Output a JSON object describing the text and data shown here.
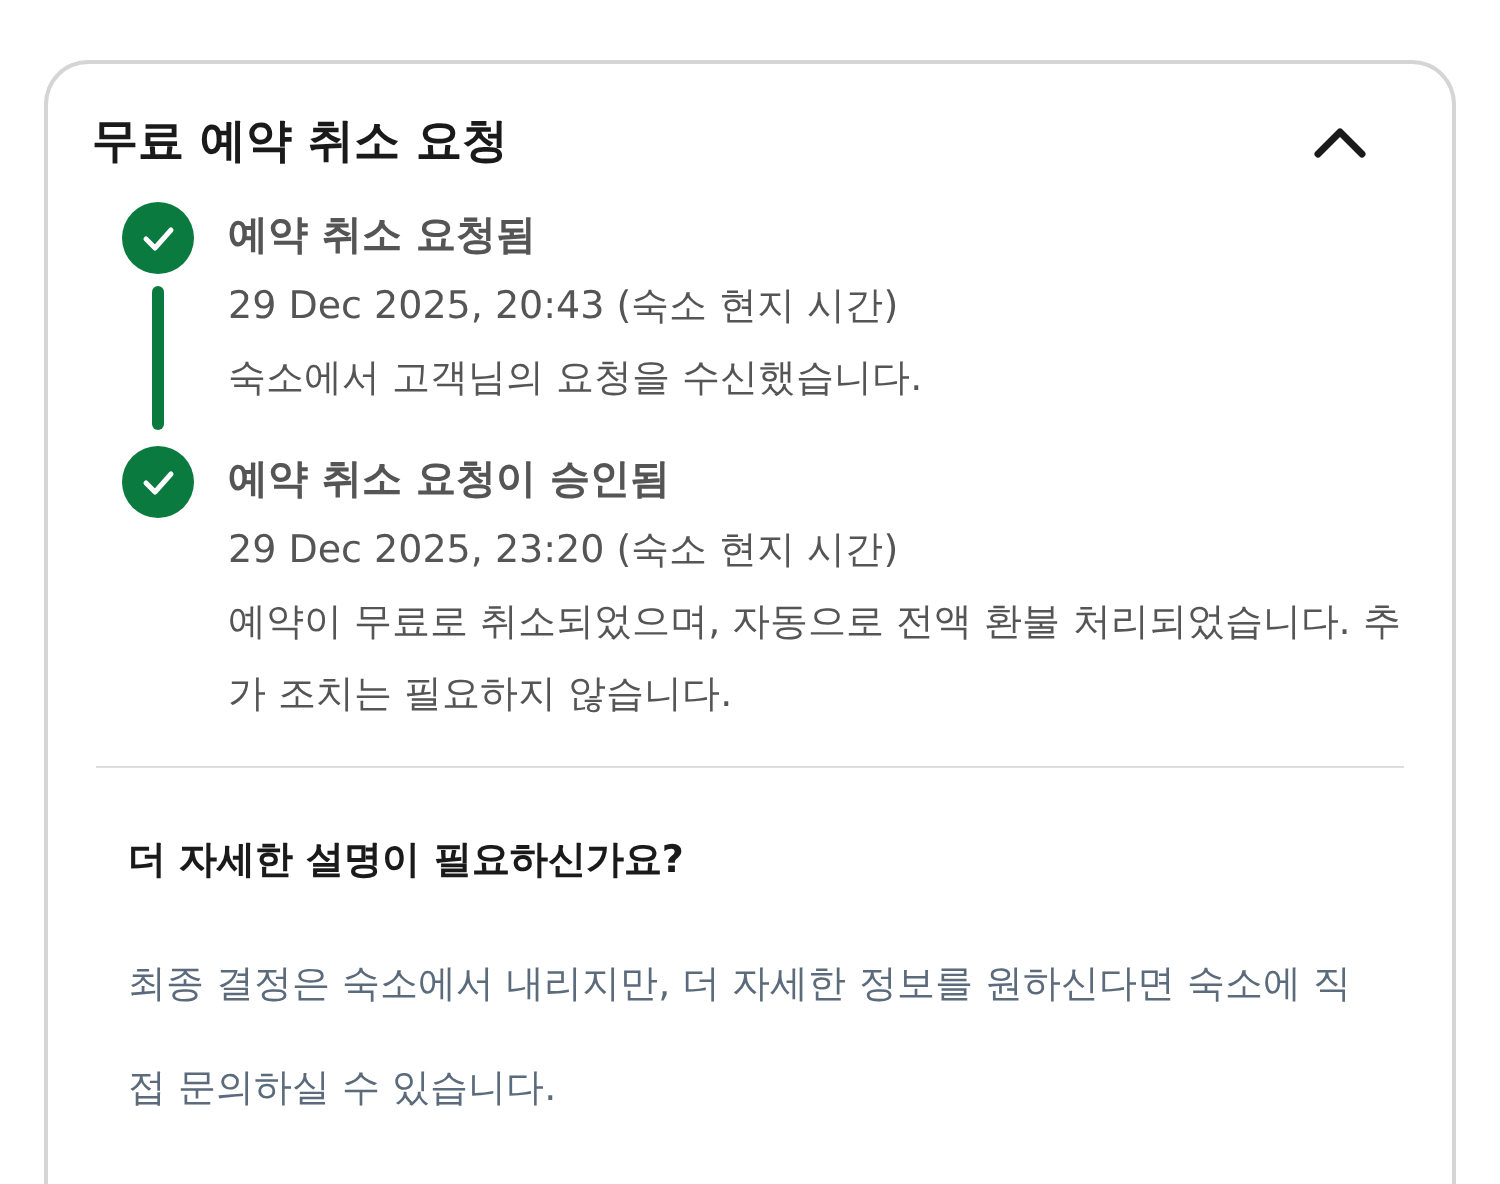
{
  "card": {
    "title": "무료 예약 취소 요청",
    "expanded": true
  },
  "timeline": [
    {
      "title": "예약 취소 요청됨",
      "time": "29 Dec 2025, 20:43 (숙소 현지 시간)",
      "description": "숙소에서 고객님의 요청을 수신했습니다.",
      "completed": true
    },
    {
      "title": "예약 취소 요청이 승인됨",
      "time": "29 Dec 2025, 23:20 (숙소 현지 시간)",
      "description": "예약이 무료로 취소되었으며, 자동으로 전액 환불 처리되었습니다. 추가 조치는 필요하지 않습니다.",
      "completed": true
    }
  ],
  "help": {
    "heading": "더 자세한 설명이 필요하신가요?",
    "text": "최종 결정은 숙소에서 내리지만, 더 자세한 정보를 원하신다면 숙소에 직접 문의하실 수 있습니다."
  }
}
